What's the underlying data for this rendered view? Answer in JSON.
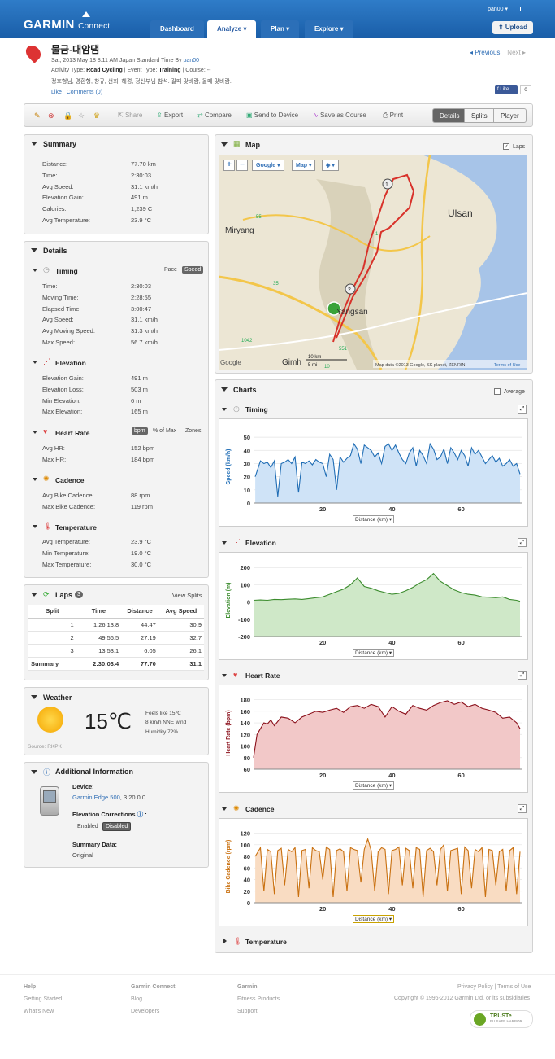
{
  "header": {
    "logo": "GARMIN",
    "logo_suffix": "Connect",
    "user": "pan00",
    "nav": [
      "Dashboard",
      "Analyze",
      "Plan",
      "Explore"
    ],
    "upload": "Upload"
  },
  "activity": {
    "title": "물금-대암댐",
    "line1_prefix": "Sat, 2013 May 18 8:11 AM Japan Standard Time By",
    "user_link": "pan00",
    "activity_type_label": "Activity Type:",
    "activity_type": "Road Cycling",
    "event_type_label": "| Event Type:",
    "event_type": "Training",
    "course_label": "| Course:",
    "course": "--",
    "description": "정호형님, 명환형, 창규, 선희, 해경, 정신부님 참석. 갈때 맞바람, 올때 맞바람.",
    "like": "Like",
    "comments": "Comments (0)",
    "previous": "Previous",
    "next": "Next",
    "fb_like": "Like",
    "fb_count": "0"
  },
  "toolbar": {
    "share": "Share",
    "export": "Export",
    "compare": "Compare",
    "send": "Send to Device",
    "save_course": "Save as Course",
    "print": "Print",
    "views": [
      "Details",
      "Splits",
      "Player"
    ]
  },
  "summary": {
    "title": "Summary",
    "rows": [
      [
        "Distance:",
        "77.70 km"
      ],
      [
        "Time:",
        "2:30:03"
      ],
      [
        "Avg Speed:",
        "31.1 km/h"
      ],
      [
        "Elevation Gain:",
        "491 m"
      ],
      [
        "Calories:",
        "1,239 C"
      ],
      [
        "Avg Temperature:",
        "23.9 °C"
      ]
    ]
  },
  "details": {
    "title": "Details",
    "timing": {
      "title": "Timing",
      "toggle": [
        "Pace",
        "Speed"
      ],
      "rows": [
        [
          "Time:",
          "2:30:03"
        ],
        [
          "Moving Time:",
          "2:28:55"
        ],
        [
          "Elapsed Time:",
          "3:00:47"
        ],
        [
          "Avg Speed:",
          "31.1 km/h"
        ],
        [
          "Avg Moving Speed:",
          "31.3 km/h"
        ],
        [
          "Max Speed:",
          "56.7 km/h"
        ]
      ]
    },
    "elevation": {
      "title": "Elevation",
      "rows": [
        [
          "Elevation Gain:",
          "491 m"
        ],
        [
          "Elevation Loss:",
          "503 m"
        ],
        [
          "Min Elevation:",
          "6 m"
        ],
        [
          "Max Elevation:",
          "165 m"
        ]
      ]
    },
    "heart_rate": {
      "title": "Heart Rate",
      "toggle": [
        "bpm",
        "% of Max",
        "Zones"
      ],
      "rows": [
        [
          "Avg HR:",
          "152 bpm"
        ],
        [
          "Max HR:",
          "184 bpm"
        ]
      ]
    },
    "cadence": {
      "title": "Cadence",
      "rows": [
        [
          "Avg Bike Cadence:",
          "88 rpm"
        ],
        [
          "Max Bike Cadence:",
          "119 rpm"
        ]
      ]
    },
    "temperature": {
      "title": "Temperature",
      "rows": [
        [
          "Avg Temperature:",
          "23.9 °C"
        ],
        [
          "Min Temperature:",
          "19.0 °C"
        ],
        [
          "Max Temperature:",
          "30.0 °C"
        ]
      ]
    }
  },
  "laps": {
    "title": "Laps",
    "count": "3",
    "view_splits": "View Splits",
    "headers": [
      "Split",
      "Time",
      "Distance",
      "Avg Speed"
    ],
    "rows": [
      [
        "1",
        "1:26:13.8",
        "44.47",
        "30.9"
      ],
      [
        "2",
        "49:56.5",
        "27.19",
        "32.7"
      ],
      [
        "3",
        "13:53.1",
        "6.05",
        "26.1"
      ],
      [
        "Summary",
        "2:30:03.4",
        "77.70",
        "31.1"
      ]
    ]
  },
  "weather": {
    "title": "Weather",
    "temp": "15℃",
    "feels": "Feels like 15℃",
    "wind": "8 km/h NNE wind",
    "humidity": "Humidity 72%",
    "source": "Source: RKPK"
  },
  "additional": {
    "title": "Additional Information",
    "device_label": "Device:",
    "device_link": "Garmin Edge 500",
    "device_ver": ", 3.20.0.0",
    "elev_corr_label": "Elevation Corrections",
    "elev_corr_opts": [
      "Enabled",
      "Disabled"
    ],
    "summary_data_label": "Summary Data:",
    "summary_data": "Original"
  },
  "map": {
    "title": "Map",
    "laps_checkbox": "Laps",
    "btn_google": "Google",
    "btn_map": "Map",
    "places": [
      "Miryang",
      "Ulsan",
      "Yangsan",
      "Gimh"
    ],
    "roads": [
      "55",
      "1",
      "35",
      "551",
      "1042",
      "10"
    ],
    "scale_km": "10 km",
    "scale_mi": "5 mi",
    "attribution": "Map data ©2013 Google, SK planet, ZENRIN -",
    "terms": "Terms of Use",
    "google": "Google",
    "lap_markers": [
      "1",
      "2"
    ],
    "colors": {
      "route": "#d8322a",
      "water": "#a7c4e8"
    }
  },
  "charts": {
    "title": "Charts",
    "average": "Average",
    "xaxis_label": "Distance (km)",
    "temperature_title": "Temperature"
  },
  "chart_data": [
    {
      "type": "area",
      "title": "Timing",
      "ylabel": "Speed (km/h)",
      "xlabel": "Distance (km)",
      "xticks": [
        20,
        40,
        60
      ],
      "yticks": [
        0,
        10,
        20,
        30,
        40,
        50
      ],
      "ylim": [
        0,
        55
      ],
      "xlim": [
        0,
        77.7
      ],
      "color": "#1f6db5",
      "fill": "#cfe3f7",
      "x": [
        0.5,
        2,
        3,
        4,
        5,
        6,
        7,
        8,
        9,
        10,
        11,
        12,
        13,
        14,
        15,
        16,
        17,
        18,
        19,
        20,
        21,
        22,
        23,
        24,
        25,
        26,
        27,
        28,
        29,
        30,
        31,
        32,
        33,
        34,
        35,
        36,
        37,
        38,
        39,
        40,
        41,
        42,
        43,
        44,
        45,
        46,
        47,
        48,
        49,
        50,
        51,
        52,
        53,
        54,
        55,
        56,
        57,
        58,
        59,
        60,
        61,
        62,
        63,
        64,
        65,
        66,
        67,
        68,
        69,
        70,
        71,
        72,
        73,
        74,
        75,
        76,
        77
      ],
      "values": [
        20,
        32,
        30,
        31,
        27,
        32,
        5,
        30,
        31,
        33,
        30,
        35,
        8,
        31,
        30,
        32,
        29,
        33,
        31,
        30,
        20,
        37,
        33,
        10,
        35,
        31,
        34,
        36,
        45,
        41,
        30,
        44,
        42,
        40,
        35,
        38,
        30,
        43,
        45,
        40,
        44,
        38,
        33,
        30,
        38,
        42,
        28,
        40,
        36,
        30,
        45,
        41,
        33,
        35,
        41,
        30,
        42,
        38,
        33,
        40,
        36,
        28,
        42,
        37,
        40,
        35,
        30,
        33,
        36,
        31,
        34,
        28,
        30,
        33,
        28,
        30,
        22
      ]
    },
    {
      "type": "area",
      "title": "Elevation",
      "ylabel": "Elevation (m)",
      "xlabel": "Distance (km)",
      "xticks": [
        20,
        40,
        60
      ],
      "yticks": [
        -200,
        -100,
        0,
        100,
        200
      ],
      "ylim": [
        -200,
        220
      ],
      "xlim": [
        0,
        77.7
      ],
      "color": "#3c8c2e",
      "fill": "#cfe8c8",
      "x": [
        0,
        2,
        4,
        6,
        8,
        10,
        12,
        14,
        16,
        18,
        20,
        22,
        24,
        26,
        28,
        30,
        32,
        34,
        36,
        38,
        40,
        42,
        44,
        46,
        48,
        50,
        52,
        54,
        56,
        58,
        60,
        62,
        64,
        66,
        68,
        70,
        72,
        74,
        76,
        77
      ],
      "values": [
        10,
        12,
        10,
        15,
        14,
        16,
        18,
        15,
        20,
        25,
        30,
        45,
        60,
        75,
        100,
        140,
        90,
        80,
        65,
        55,
        45,
        50,
        65,
        85,
        110,
        130,
        165,
        120,
        95,
        70,
        55,
        45,
        40,
        30,
        28,
        25,
        30,
        15,
        10,
        5
      ]
    },
    {
      "type": "area",
      "title": "Heart Rate",
      "ylabel": "Heart Rate (bpm)",
      "xlabel": "Distance (km)",
      "xticks": [
        20,
        40,
        60
      ],
      "yticks": [
        60,
        80,
        100,
        120,
        140,
        160,
        180
      ],
      "ylim": [
        60,
        185
      ],
      "xlim": [
        0,
        77.7
      ],
      "color": "#8a0f1a",
      "fill": "#f2c8c8",
      "x": [
        0,
        1,
        2,
        3,
        4,
        5,
        6,
        8,
        10,
        12,
        14,
        16,
        18,
        20,
        22,
        24,
        26,
        28,
        30,
        32,
        34,
        36,
        38,
        40,
        42,
        44,
        46,
        48,
        50,
        52,
        54,
        56,
        58,
        60,
        62,
        64,
        66,
        68,
        70,
        72,
        74,
        76,
        77
      ],
      "values": [
        80,
        120,
        130,
        140,
        138,
        145,
        135,
        150,
        148,
        140,
        150,
        155,
        160,
        158,
        162,
        165,
        158,
        168,
        170,
        165,
        172,
        168,
        150,
        168,
        160,
        155,
        170,
        165,
        162,
        170,
        175,
        178,
        172,
        176,
        168,
        172,
        165,
        162,
        158,
        148,
        150,
        140,
        130
      ]
    },
    {
      "type": "area",
      "title": "Cadence",
      "ylabel": "Bike Cadence (rpm)",
      "xlabel": "Distance (km)",
      "xticks": [
        20,
        40,
        60
      ],
      "yticks": [
        0,
        20,
        40,
        60,
        80,
        100,
        120
      ],
      "ylim": [
        0,
        125
      ],
      "xlim": [
        0,
        77.7
      ],
      "color": "#c9700f",
      "fill": "#f9dcc2",
      "x": [
        0.5,
        2,
        3,
        4,
        5,
        6,
        7,
        8,
        9,
        10,
        11,
        12,
        13,
        14,
        15,
        16,
        17,
        18,
        19,
        20,
        21,
        22,
        23,
        24,
        25,
        26,
        27,
        28,
        29,
        30,
        31,
        32,
        33,
        34,
        35,
        36,
        37,
        38,
        39,
        40,
        41,
        42,
        43,
        44,
        45,
        46,
        47,
        48,
        49,
        50,
        51,
        52,
        53,
        54,
        55,
        56,
        57,
        58,
        59,
        60,
        61,
        62,
        63,
        64,
        65,
        66,
        67,
        68,
        69,
        70,
        71,
        72,
        73,
        74,
        75,
        76,
        77
      ],
      "values": [
        80,
        95,
        20,
        92,
        88,
        15,
        90,
        94,
        30,
        92,
        88,
        95,
        10,
        90,
        92,
        25,
        95,
        90,
        88,
        40,
        96,
        92,
        10,
        90,
        93,
        88,
        20,
        95,
        92,
        90,
        35,
        92,
        110,
        90,
        20,
        88,
        95,
        92,
        15,
        90,
        92,
        96,
        30,
        94,
        90,
        25,
        95,
        92,
        10,
        90,
        94,
        88,
        30,
        92,
        100,
        20,
        90,
        92,
        94,
        15,
        96,
        90,
        25,
        92,
        88,
        95,
        10,
        92,
        90,
        30,
        88,
        92,
        20,
        90,
        95,
        15,
        88
      ]
    }
  ],
  "footer": {
    "help": {
      "title": "Help",
      "items": [
        "Getting Started",
        "What's New"
      ]
    },
    "connect": {
      "title": "Garmin Connect",
      "items": [
        "Blog",
        "Developers"
      ]
    },
    "garmin": {
      "title": "Garmin",
      "items": [
        "Fitness Products",
        "Support"
      ]
    },
    "privacy": "Privacy Policy",
    "terms": "Terms of Use",
    "copyright": "Copyright © 1996-2012 Garmin Ltd. or its subsidiaries",
    "truste": "TRUSTe",
    "truste_sub": "EU SAFE HARBOR"
  }
}
